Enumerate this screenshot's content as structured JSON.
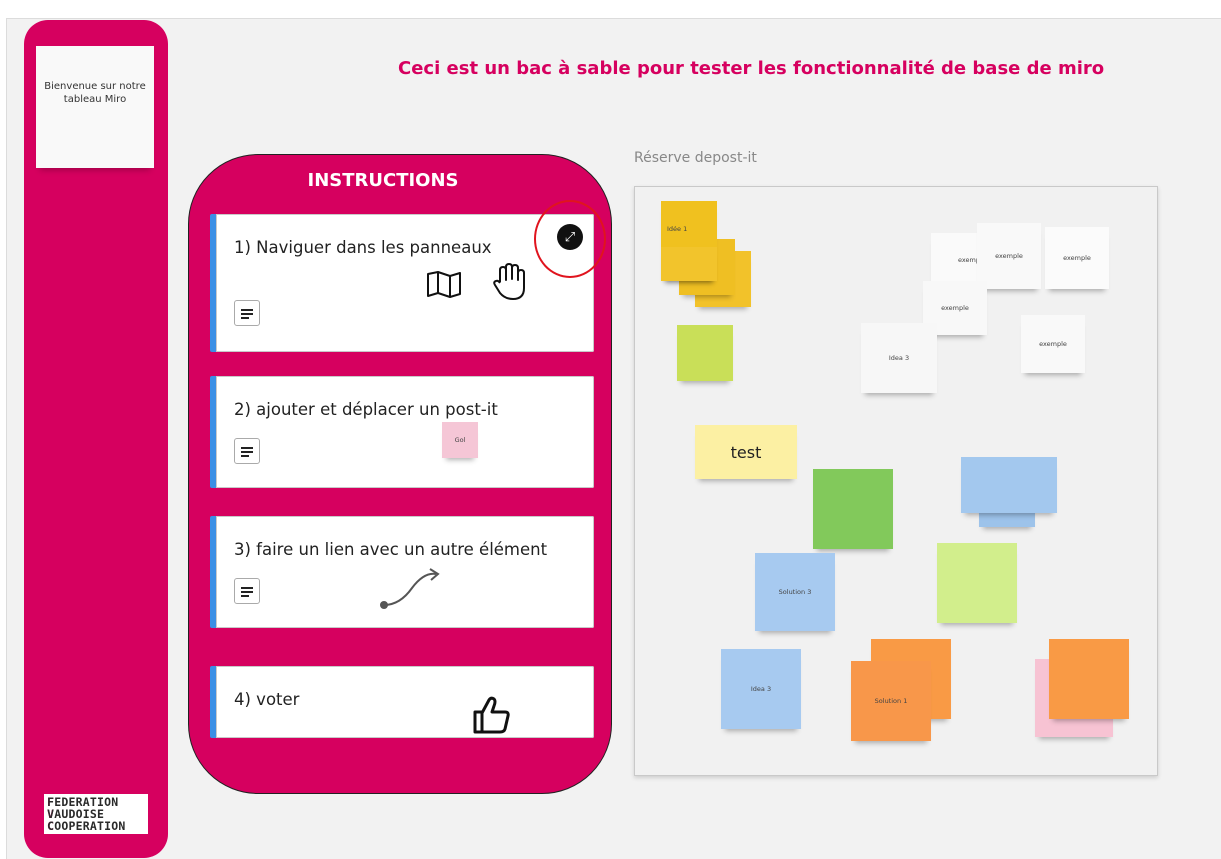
{
  "page": {
    "title": "Ceci est un bac à sable pour tester les fonctionnalité de base de miro"
  },
  "welcome_note": "Bienvenue sur notre tableau Miro",
  "logo": {
    "line1": "FEDERATION",
    "line2": "VAUDOISE",
    "line3": "COOPERATION"
  },
  "instructions": {
    "title": "INSTRUCTIONS",
    "items": [
      {
        "label": "1) Naviguer dans les panneaux"
      },
      {
        "label": "2) ajouter et déplacer un post-it",
        "sticker": "Gol"
      },
      {
        "label": "3) faire un lien avec un autre élément"
      },
      {
        "label": "4) voter"
      }
    ]
  },
  "reserve": {
    "label": "Réserve depost-it",
    "stickies": {
      "idee1": "Idée 1",
      "exemple_a": "exemp",
      "exemple_b": "exemple",
      "exemple_c": "exemple",
      "exemple_d": "exemple",
      "exemple_e": "exemple",
      "idea3_white": "Idea 3",
      "test": "test",
      "solution3": "Solution 3",
      "idea3_blue": "Idea 3",
      "solution1": "Solution 1"
    }
  },
  "colors": {
    "brand": "#d6005f",
    "card_accent": "#3b8fe5",
    "highlight_ring": "#e0141e"
  }
}
